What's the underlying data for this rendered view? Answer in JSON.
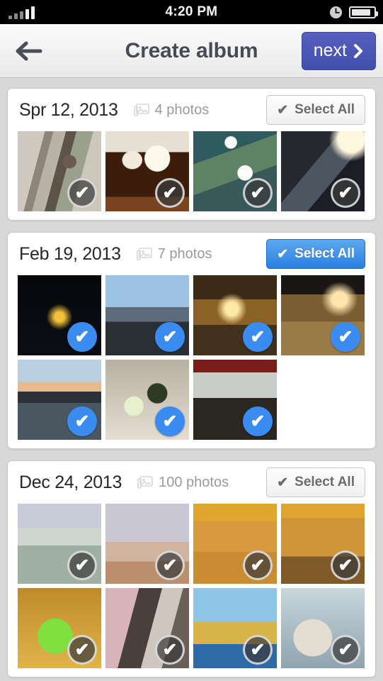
{
  "status_bar": {
    "time": "4:20 PM",
    "signal_icon": "signal-bars-icon",
    "alarm_icon": "clock-icon",
    "battery_icon": "battery-icon"
  },
  "nav": {
    "back_icon": "back-arrow-icon",
    "title": "Create album",
    "next_label": "next",
    "next_icon": "chevron-right-icon",
    "next_color": "#434eae"
  },
  "colors": {
    "page_bg": "#d8d8d8",
    "card_bg": "#ffffff",
    "accent_blue": "#3b8cf0",
    "select_all_active": "#2a7fe0"
  },
  "sections": [
    {
      "date": "Spr 12, 2013",
      "count_label": "4 photos",
      "count_icon": "photos-stack-icon",
      "select_all": {
        "label": "Select All",
        "icon": "check-icon",
        "active": false
      },
      "photos": [
        {
          "name": "photo-street-walker",
          "art": "p-street",
          "selected": false
        },
        {
          "name": "photo-beer-glasses",
          "art": "p-beer",
          "selected": false
        },
        {
          "name": "photo-swans-water",
          "art": "p-swan",
          "selected": false
        },
        {
          "name": "photo-building-arch",
          "art": "p-arch",
          "selected": false
        }
      ]
    },
    {
      "date": "Feb 19, 2013",
      "count_label": "7 photos",
      "count_icon": "photos-stack-icon",
      "select_all": {
        "label": "Select All",
        "icon": "check-icon",
        "active": true
      },
      "photos": [
        {
          "name": "photo-eiffel-tower",
          "art": "p-eiffel",
          "selected": true
        },
        {
          "name": "photo-man-riverside",
          "art": "p-man",
          "selected": true
        },
        {
          "name": "photo-cafe-night",
          "art": "p-cafe",
          "selected": true
        },
        {
          "name": "photo-street-night",
          "art": "p-street2",
          "selected": true
        },
        {
          "name": "photo-seine-sunset",
          "art": "p-seine",
          "selected": true
        },
        {
          "name": "photo-mussels-meal",
          "art": "p-food",
          "selected": true
        },
        {
          "name": "photo-terrace-diners",
          "art": "p-terrace",
          "selected": true
        }
      ]
    },
    {
      "date": "Dec 24, 2013",
      "count_label": "100 photos",
      "count_icon": "photos-stack-icon",
      "select_all": {
        "label": "Select All",
        "icon": "check-icon",
        "active": false
      },
      "photos": [
        {
          "name": "photo-fair-tickets",
          "art": "p-fair1",
          "selected": false
        },
        {
          "name": "photo-fair-ride",
          "art": "p-fair2",
          "selected": false
        },
        {
          "name": "photo-fair-crowd",
          "art": "p-crowd1",
          "selected": false
        },
        {
          "name": "photo-fair-booth",
          "art": "p-crowd2",
          "selected": false
        },
        {
          "name": "photo-alien-inflatable",
          "art": "p-alien",
          "selected": false
        },
        {
          "name": "photo-shop-window",
          "art": "p-shop",
          "selected": false
        },
        {
          "name": "photo-ferris-wheel",
          "art": "p-wheel",
          "selected": false
        },
        {
          "name": "photo-person-drink",
          "art": "p-person",
          "selected": false
        }
      ]
    }
  ]
}
